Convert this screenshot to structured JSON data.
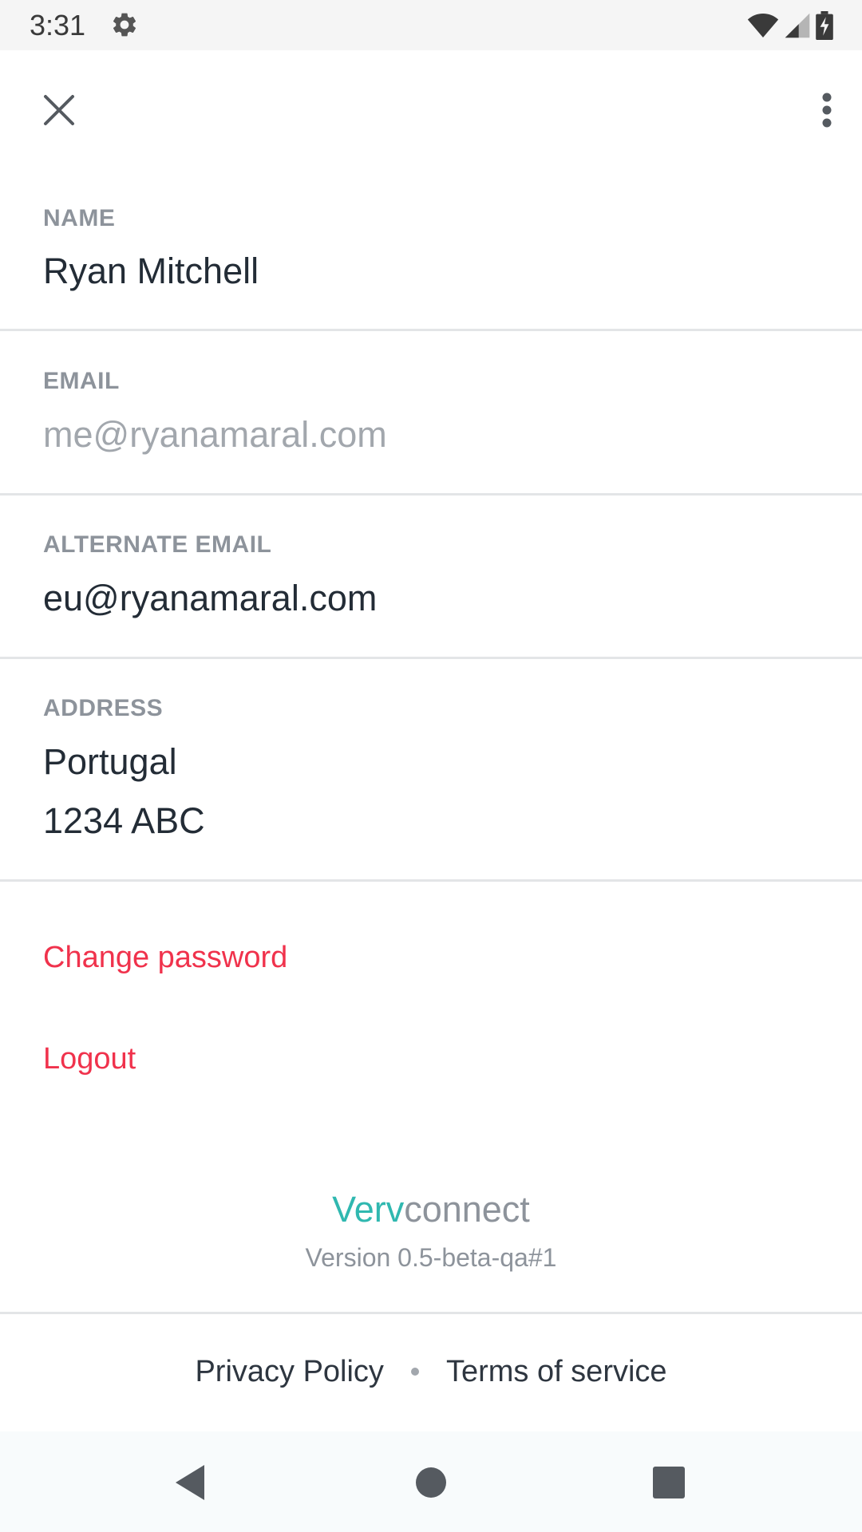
{
  "status_bar": {
    "time": "3:31",
    "icons": [
      "gear-icon",
      "wifi-icon",
      "signal-icon",
      "battery-charging-icon"
    ]
  },
  "app_bar": {
    "close_icon": "close-icon",
    "more_icon": "more-vert-icon"
  },
  "fields": {
    "name": {
      "label": "NAME",
      "value": "Ryan Mitchell"
    },
    "email": {
      "label": "EMAIL",
      "value": "me@ryanamaral.com"
    },
    "alternate_email": {
      "label": "ALTERNATE EMAIL",
      "value": "eu@ryanamaral.com"
    },
    "address": {
      "label": "ADDRESS",
      "line1": "Portugal",
      "line2": "1234 ABC"
    }
  },
  "actions": {
    "change_password": "Change password",
    "logout": "Logout"
  },
  "brand": {
    "verv": "Verv",
    "connect": "connect",
    "version": "Version 0.5-beta-qa#1"
  },
  "footer": {
    "privacy": "Privacy Policy",
    "terms": "Terms of service"
  },
  "colors": {
    "accent_red": "#f0324c",
    "brand_teal": "#30b8b0",
    "label_gray": "#8d939b",
    "text_dark": "#232c36"
  }
}
